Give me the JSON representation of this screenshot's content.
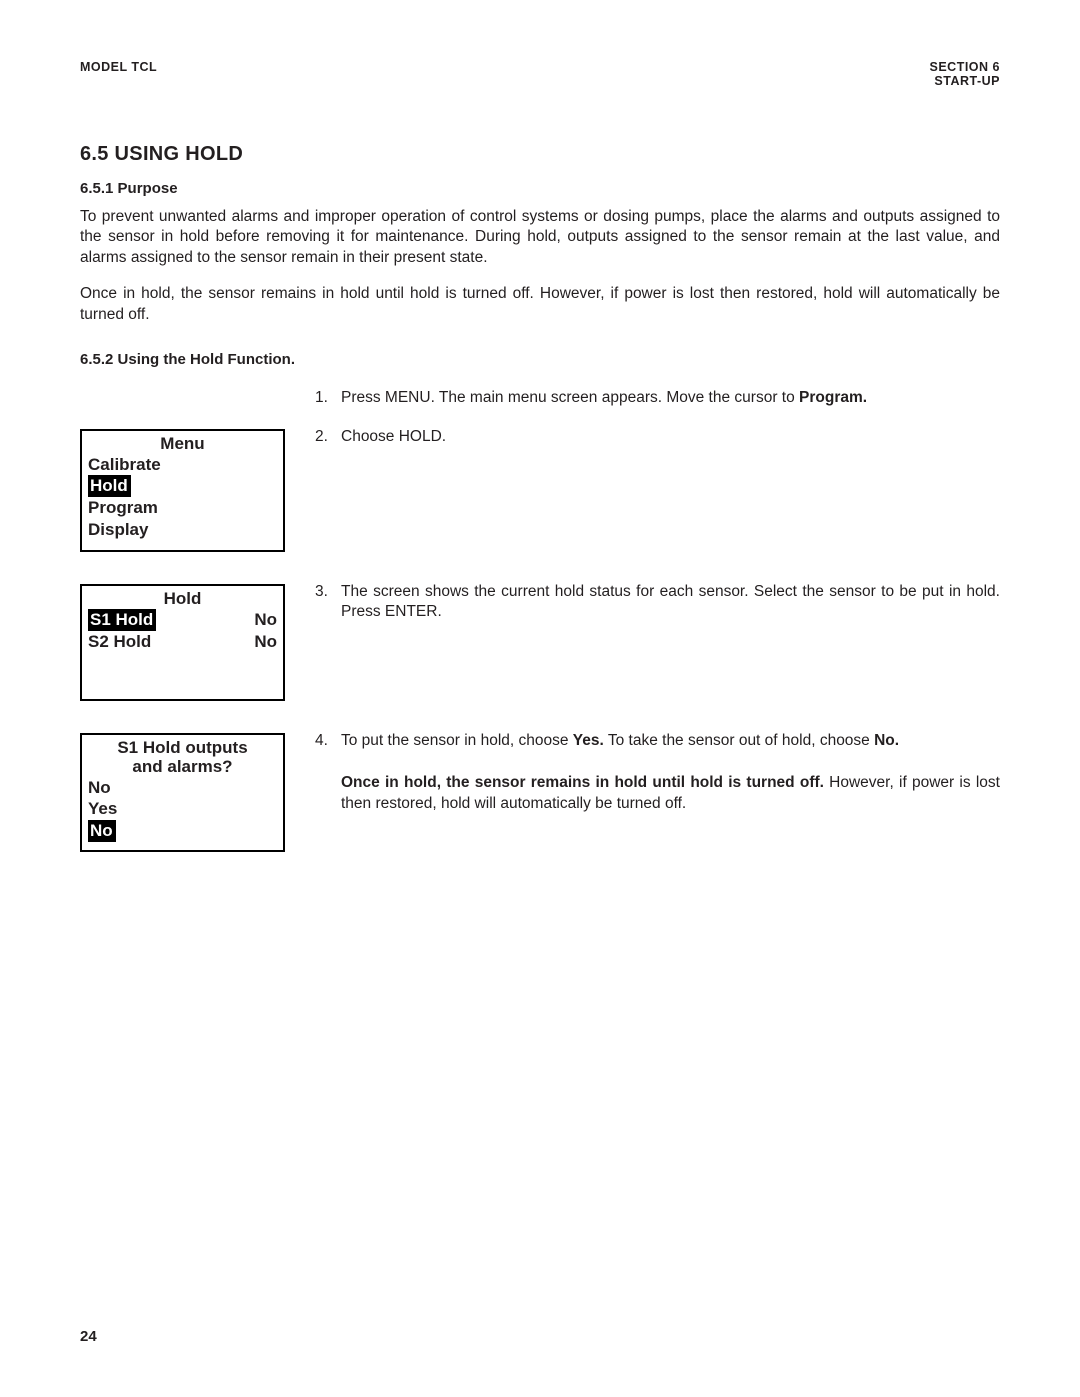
{
  "header": {
    "left": "MODEL TCL",
    "right_line1": "SECTION 6",
    "right_line2": "START-UP"
  },
  "title": "6.5 USING HOLD",
  "purpose_heading": "6.5.1 Purpose",
  "purpose_p1": "To prevent unwanted alarms and improper operation of control systems or dosing pumps, place the alarms and outputs assigned to the sensor in hold before removing it for maintenance. During hold, outputs assigned to the sensor remain at the last value, and alarms assigned to the sensor remain in their present state.",
  "purpose_p2": "Once in hold, the sensor remains in hold until hold is turned off. However, if power is lost then restored, hold will automatically be turned off.",
  "using_heading": "6.5.2 Using the Hold Function.",
  "steps": {
    "s1": {
      "num": "1.",
      "a": "Press MENU. The main menu screen appears. Move the cursor to ",
      "b": "Program."
    },
    "s2": {
      "num": "2.",
      "text": "Choose HOLD."
    },
    "s3": {
      "num": "3.",
      "text": "The screen shows the current hold status for each sensor. Select the sensor to be put in hold. Press ENTER."
    },
    "s4": {
      "num": "4.",
      "a": "To put the sensor in hold, choose ",
      "b": "Yes.",
      "c": " To take the sensor out of hold, choose ",
      "d": "No.",
      "note_bold": "Once in hold, the sensor remains in hold until hold is turned off.",
      "note_rest": " However, if power is lost then restored, hold will automatically be turned off."
    }
  },
  "lcd1": {
    "title": "Menu",
    "l1": "Calibrate",
    "l2": "Hold",
    "l3": "Program",
    "l4": "Display"
  },
  "lcd2": {
    "title": "Hold",
    "r1_left": "S1 Hold",
    "r1_right": "No",
    "r2_left": "S2 Hold",
    "r2_right": "No"
  },
  "lcd3": {
    "title1": "S1 Hold outputs",
    "title2": "and alarms?",
    "l1": "No",
    "l2": "Yes",
    "l3": "No"
  },
  "page_number": "24"
}
